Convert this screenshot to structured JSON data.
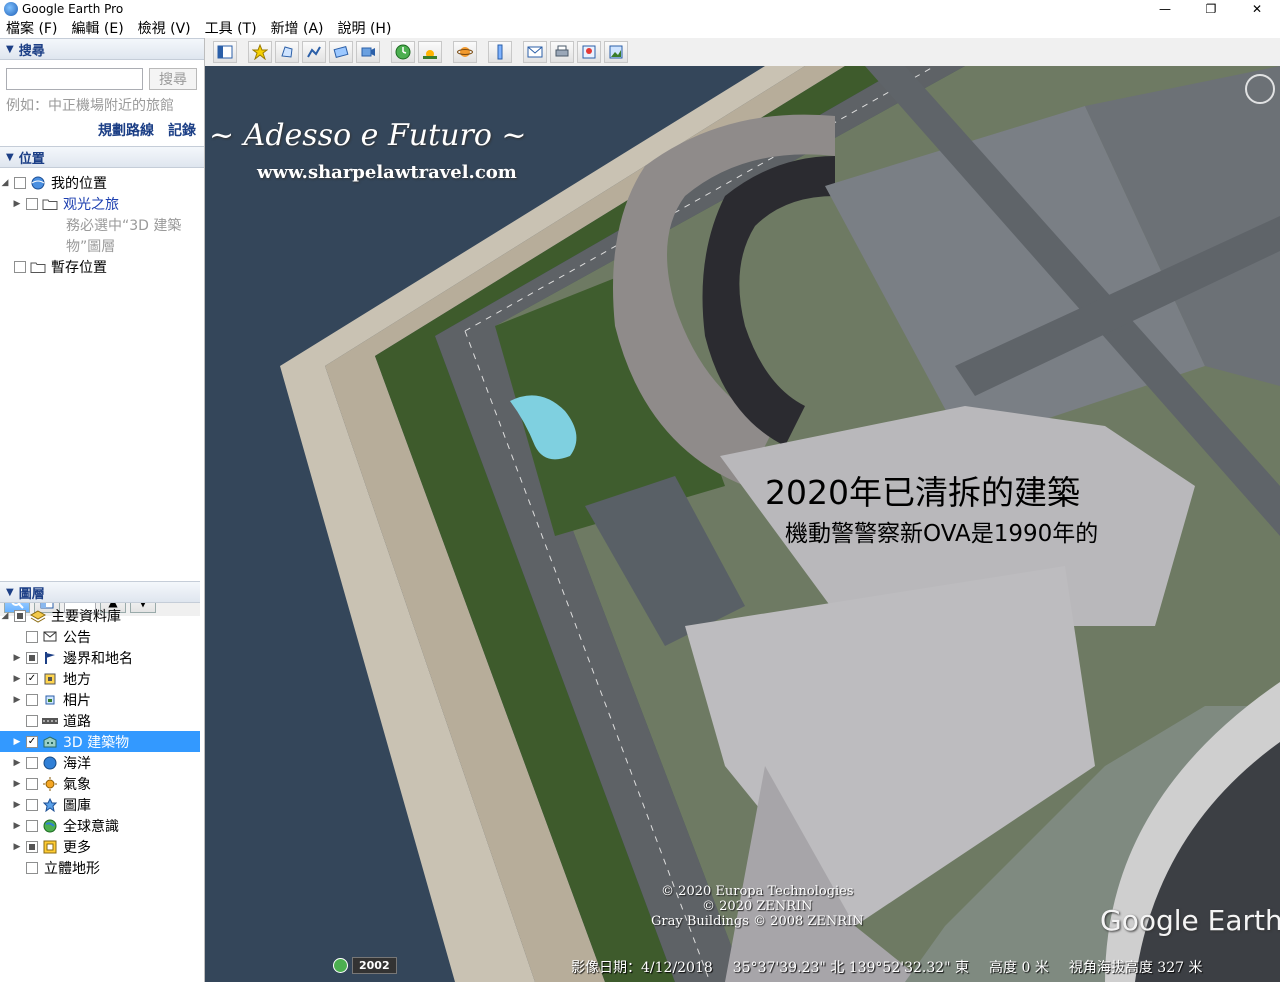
{
  "window": {
    "title": "Google Earth Pro",
    "minimize": "—",
    "maximize": "❐",
    "close": "✕"
  },
  "menu": [
    "檔案 (F)",
    "編輯 (E)",
    "檢視 (V)",
    "工具 (T)",
    "新增 (A)",
    "說明 (H)"
  ],
  "search": {
    "header": "搜尋",
    "button": "搜尋",
    "hint": "例如：中正機場附近的旅館",
    "route_link": "規劃路線",
    "history_link": "記錄"
  },
  "places": {
    "header": "位置",
    "items": [
      {
        "label": "我的位置"
      },
      {
        "label": "观光之旅"
      },
      {
        "label": "務必選中“3D 建築"
      },
      {
        "label": "物”圖層"
      },
      {
        "label": "暫存位置"
      }
    ]
  },
  "layers": {
    "header": "圖層",
    "items": [
      {
        "label": "主要資料庫"
      },
      {
        "label": "公告"
      },
      {
        "label": "邊界和地名"
      },
      {
        "label": "地方"
      },
      {
        "label": "相片"
      },
      {
        "label": "道路"
      },
      {
        "label": "3D 建築物"
      },
      {
        "label": "海洋"
      },
      {
        "label": "氣象"
      },
      {
        "label": "圖庫"
      },
      {
        "label": "全球意識"
      },
      {
        "label": "更多"
      },
      {
        "label": "立體地形"
      }
    ]
  },
  "map": {
    "watermark_title": "~ Adesso e Futuro ~",
    "watermark_url": "www.sharpelawtravel.com",
    "overlay_title": "2020年已清拆的建築",
    "overlay_subtitle": "機動警警察新OVA是1990年的",
    "copyright_1": "© 2020 Europa Technologies",
    "copyright_2": "© 2020 ZENRIN",
    "copyright_3": "Gray Buildings © 2008 ZENRIN",
    "logo": "Google Earth",
    "year": "2002",
    "imagery_date": "影像日期：4/12/2018",
    "coordinates": "35°37'39.23\" 北 139°52'32.32\" 東",
    "altitude": "高度 0 米",
    "eye_alt": "視角海拔高度 327 米"
  },
  "colors": {
    "accent": "#1c3f86",
    "selection": "#3399ff",
    "water": "#3a4a5c"
  }
}
